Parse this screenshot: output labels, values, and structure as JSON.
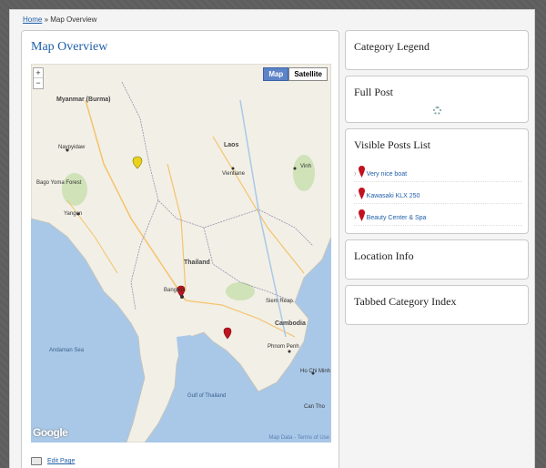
{
  "breadcrumb": {
    "home": "Home",
    "separator": "»",
    "current": "Map Overview"
  },
  "main": {
    "title": "Map Overview",
    "map": {
      "zoom_in": "+",
      "zoom_out": "−",
      "type_map": "Map",
      "type_satellite": "Satellite",
      "logo": "Google",
      "attribution": "Map Data - Terms of Use",
      "labels": [
        "Myanmar (Burma)",
        "Naypyidaw",
        "Bago Yoma Forest",
        "Yangon",
        "Laos",
        "Vientiane",
        "Thailand",
        "Bangkok",
        "Cambodia",
        "Phnom Penh",
        "Andaman Sea",
        "Gulf of Thailand",
        "Ho Chi Minh",
        "Siem Reap",
        "Can Tho",
        "Vinh"
      ]
    },
    "edit_label": "Edit Page"
  },
  "sidebar": {
    "category_legend": "Category Legend",
    "full_post": "Full Post",
    "visible_posts": {
      "title": "Visible Posts List",
      "items": [
        "Very nice boat",
        "Kawasaki KLX 250",
        "Beauty Center & Spa"
      ]
    },
    "location_info": "Location Info",
    "tabbed_index": "Tabbed Category Index"
  },
  "colors": {
    "link": "#1f5fa8",
    "water": "#a9c8e8",
    "land": "#f2efe6",
    "pin_red": "#c1121f",
    "pin_yellow": "#e8d21a"
  }
}
